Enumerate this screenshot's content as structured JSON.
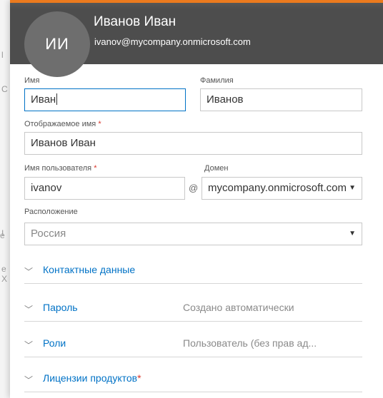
{
  "background": {
    "fragments": [
      "l",
      "C",
      "I",
      "e",
      "e",
      "X"
    ]
  },
  "header": {
    "avatar_initials": "ИИ",
    "display_name": "Иванов Иван",
    "email": "ivanov@mycompany.onmicrosoft.com"
  },
  "form": {
    "first_name": {
      "label": "Имя",
      "value": "Иван"
    },
    "last_name": {
      "label": "Фамилия",
      "value": "Иванов"
    },
    "display_name": {
      "label": "Отображаемое имя",
      "required": "*",
      "value": "Иванов Иван"
    },
    "username": {
      "label": "Имя пользователя",
      "required": "*",
      "value": "ivanov",
      "at_sign": "@"
    },
    "domain": {
      "label": "Домен",
      "value": "mycompany.onmicrosoft.com"
    },
    "location": {
      "label": "Расположение",
      "value": "Россия"
    }
  },
  "sections": [
    {
      "title": "Контактные данные",
      "value": ""
    },
    {
      "title": "Пароль",
      "value": "Создано автоматически"
    },
    {
      "title": "Роли",
      "value": "Пользователь (без прав ад..."
    },
    {
      "title": "Лицензии продуктов",
      "required": "*",
      "value": ""
    }
  ],
  "colors": {
    "accent": "#eb7a1e",
    "header_bg": "#4d4d4d",
    "link": "#0072c6",
    "required": "#d9372c"
  }
}
